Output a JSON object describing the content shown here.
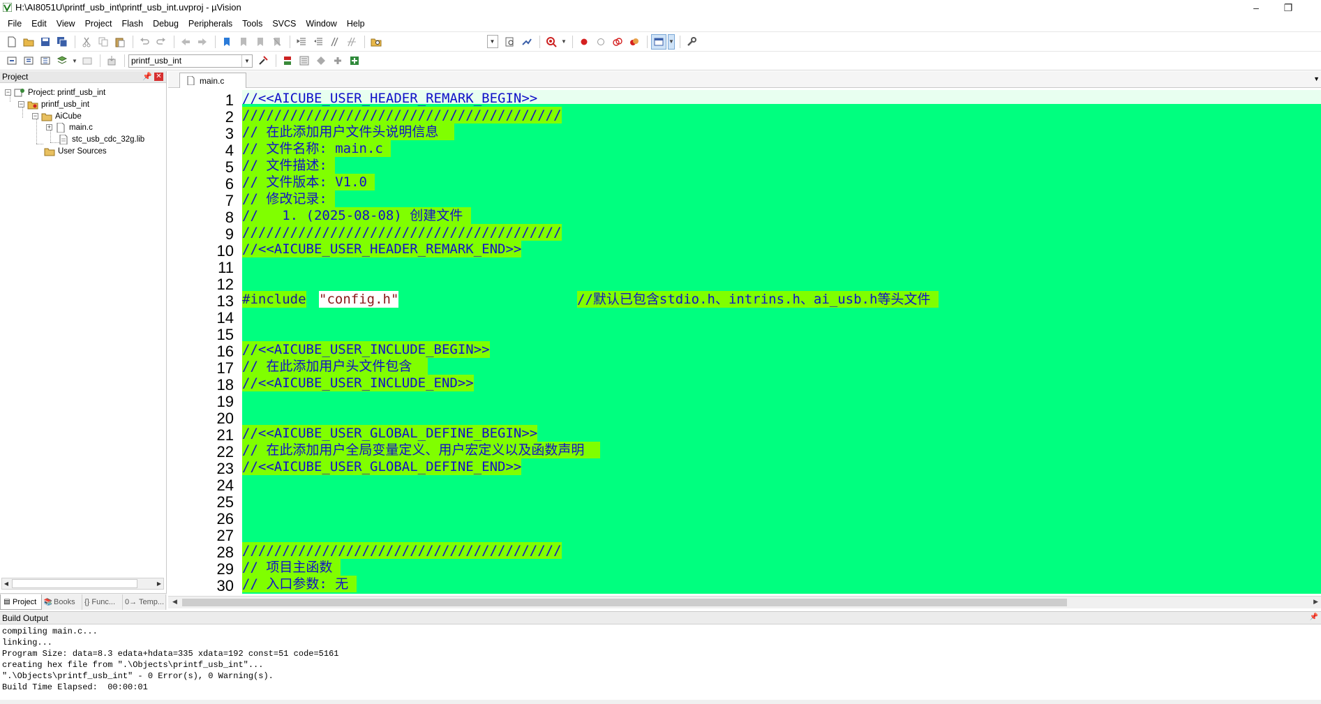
{
  "window": {
    "title": "H:\\AI8051U\\printf_usb_int\\printf_usb_int.uvproj - µVision",
    "minimize": "–",
    "restore": "❐",
    "close": "✕"
  },
  "menu": [
    "File",
    "Edit",
    "View",
    "Project",
    "Flash",
    "Debug",
    "Peripherals",
    "Tools",
    "SVCS",
    "Window",
    "Help"
  ],
  "toolbar2": {
    "target": "printf_usb_int"
  },
  "project_panel": {
    "title": "Project",
    "tree": {
      "root": "Project: printf_usb_int",
      "target": "printf_usb_int",
      "group": "AiCube",
      "file1": "main.c",
      "file2": "stc_usb_cdc_32g.lib",
      "group2": "User Sources"
    },
    "tabs": [
      "Project",
      "Books",
      "{} Func...",
      "0→ Temp..."
    ]
  },
  "editor": {
    "tab": "main.c",
    "line_numbers": [
      "1",
      "2",
      "3",
      "4",
      "5",
      "6",
      "7",
      "8",
      "9",
      "10",
      "11",
      "12",
      "13",
      "14",
      "15",
      "16",
      "17",
      "18",
      "19",
      "20",
      "21",
      "22",
      "23",
      "24",
      "25",
      "26",
      "27",
      "28",
      "29",
      "30"
    ],
    "lines": {
      "l1": "//<<AICUBE_USER_HEADER_REMARK_BEGIN>>",
      "l2": "////////////////////////////////////////",
      "l3": "// 在此添加用户文件头说明信息  ",
      "l4": "// 文件名称: main.c ",
      "l5": "// 文件描述: ",
      "l6": "// 文件版本: V1.0 ",
      "l7": "// 修改记录: ",
      "l8": "//   1. (2025-08-08) 创建文件 ",
      "l9": "////////////////////////////////////////",
      "l10": "//<<AICUBE_USER_HEADER_REMARK_END>>",
      "l13_kw": "#include",
      "l13_str": "\"config.h\"",
      "l13_cmt": "//默认已包含stdio.h、intrins.h、ai_usb.h等头文件 ",
      "l16": "//<<AICUBE_USER_INCLUDE_BEGIN>>",
      "l17": "// 在此添加用户头文件包含  ",
      "l18": "//<<AICUBE_USER_INCLUDE_END>>",
      "l21": "//<<AICUBE_USER_GLOBAL_DEFINE_BEGIN>>",
      "l22": "// 在此添加用户全局变量定义、用户宏定义以及函数声明  ",
      "l23": "//<<AICUBE_USER_GLOBAL_DEFINE_END>>",
      "l28": "////////////////////////////////////////",
      "l29": "// 项目主函数 ",
      "l30": "// 入口参数: 无 "
    }
  },
  "build_output": {
    "title": "Build Output",
    "lines": [
      "compiling main.c...",
      "linking...",
      "Program Size: data=8.3 edata+hdata=335 xdata=192 const=51 code=5161",
      "creating hex file from \".\\Objects\\printf_usb_int\"...",
      "\".\\Objects\\printf_usb_int\" - 0 Error(s), 0 Warning(s).",
      "Build Time Elapsed:  00:00:01"
    ]
  },
  "colors": {
    "editor_bg": "#00ff7f",
    "highlight": "#80ff00",
    "comment": "#1010c8",
    "panel_close": "#d62f2f"
  }
}
